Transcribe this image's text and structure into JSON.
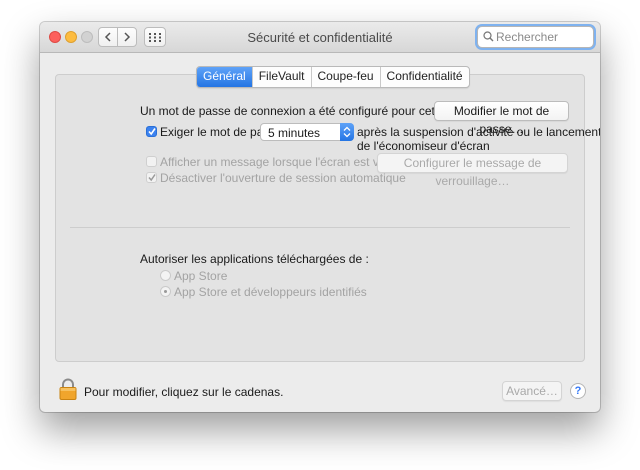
{
  "window": {
    "title": "Sécurité et confidentialité"
  },
  "search": {
    "placeholder": "Rechercher"
  },
  "tabs": [
    {
      "label": "Général",
      "active": true
    },
    {
      "label": "FileVault",
      "active": false
    },
    {
      "label": "Coupe-feu",
      "active": false
    },
    {
      "label": "Confidentialité",
      "active": false
    }
  ],
  "general": {
    "password_text": "Un mot de passe de connexion a été configuré pour cet utilisateur",
    "change_password_button": "Modifier le mot de passe…",
    "require_password": {
      "label": "Exiger le mot de passe",
      "checked": true,
      "delay_value": "5 minutes",
      "after_text_line1": "après la suspension d'activité ou le lancement",
      "after_text_line2": "de l'économiseur d'écran"
    },
    "show_message": {
      "label": "Afficher un message lorsque l'écran est verrouillé",
      "checked": false,
      "enabled": false,
      "button": "Configurer le message de verrouillage…"
    },
    "disable_auto_login": {
      "label": "Désactiver l'ouverture de session automatique",
      "checked": true,
      "enabled": false
    },
    "allow_apps": {
      "heading": "Autoriser les applications téléchargées de :",
      "options": [
        {
          "label": "App Store",
          "selected": false
        },
        {
          "label": "App Store et développeurs identifiés",
          "selected": true
        }
      ]
    }
  },
  "footer": {
    "lock_text": "Pour modifier, cliquez sur le cadenas.",
    "advanced_button": "Avancé…",
    "help": "?"
  },
  "colors": {
    "accent": "#2f7ae5",
    "lock": "#f0a52c"
  }
}
